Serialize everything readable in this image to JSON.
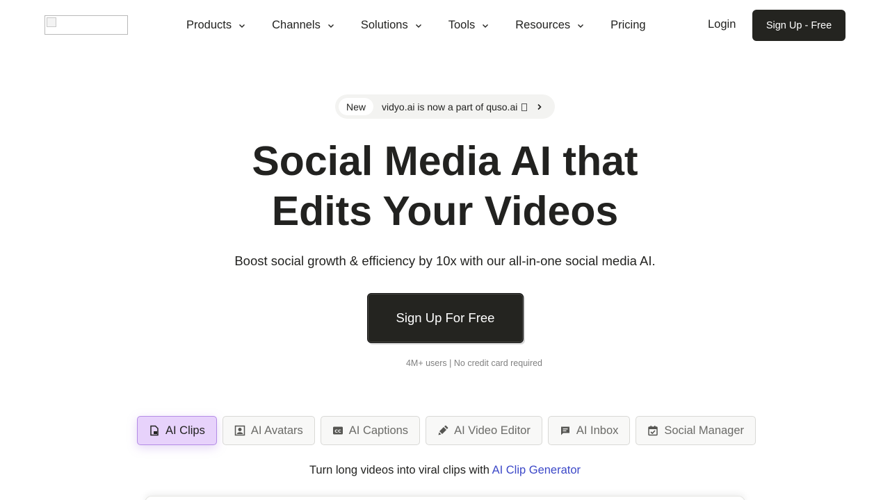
{
  "header": {
    "logo_alt": "",
    "nav": [
      {
        "label": "Products",
        "icon": "chevron-down-icon"
      },
      {
        "label": "Channels",
        "icon": "chevron-down-icon"
      },
      {
        "label": "Solutions",
        "icon": "chevron-down-icon"
      },
      {
        "label": "Tools",
        "icon": "chevron-down-icon"
      },
      {
        "label": "Resources",
        "icon": "chevron-down-icon"
      },
      {
        "label": "Pricing"
      }
    ],
    "login_label": "Login",
    "signup_label": "Sign Up - Free"
  },
  "announcement": {
    "badge": "New",
    "text": "vidyo.ai is now a part of quso.ai",
    "icon": "chevron-right-icon"
  },
  "hero": {
    "title_line1": "Social Media AI that",
    "title_line2": "Edits Your Videos",
    "subtitle": "Boost social growth & efficiency by 10x with our all-in-one social media AI.",
    "cta_label": "Sign Up For Free",
    "cta_note": "4M+ users | No credit card required"
  },
  "tabs": {
    "items": [
      {
        "label": "AI Clips",
        "icon": "clips-file-icon",
        "active": true
      },
      {
        "label": "AI Avatars",
        "icon": "avatar-icon",
        "active": false
      },
      {
        "label": "AI Captions",
        "icon": "captions-icon",
        "active": false
      },
      {
        "label": "AI Video Editor",
        "icon": "edit-brush-icon",
        "active": false
      },
      {
        "label": "AI Inbox",
        "icon": "chat-icon",
        "active": false
      },
      {
        "label": "Social Manager",
        "icon": "calendar-check-icon",
        "active": false
      }
    ],
    "description": "Turn long videos into viral clips with",
    "description_link": "AI Clip Generator"
  },
  "colors": {
    "primary_dark": "#242420",
    "active_tab_bg": "#e7d2fb",
    "active_tab_border": "#b48ce6",
    "link": "#3c48c8"
  }
}
